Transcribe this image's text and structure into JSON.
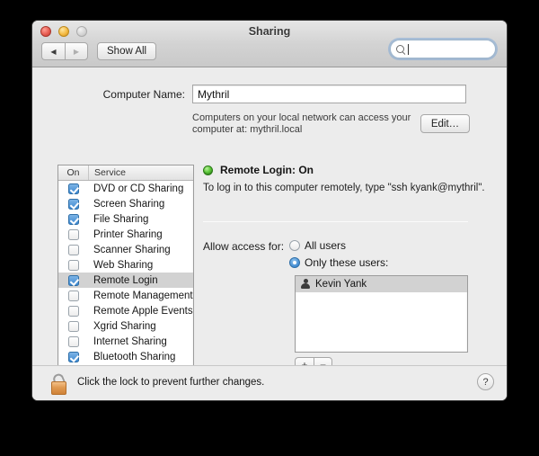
{
  "window": {
    "title": "Sharing",
    "traffic_lights": [
      "close-button",
      "minimize-button",
      "zoom-button"
    ],
    "nav_back": "◀",
    "nav_forward": "▶",
    "show_all_label": "Show All",
    "search_placeholder": "",
    "search_value": ""
  },
  "computer_name": {
    "label": "Computer Name:",
    "value": "Mythril",
    "help_text": "Computers on your local network can access your computer at: mythril.local",
    "edit_label": "Edit…"
  },
  "services": {
    "columns": [
      "On",
      "Service"
    ],
    "rows": [
      {
        "name": "DVD or CD Sharing",
        "on": true,
        "selected": false
      },
      {
        "name": "Screen Sharing",
        "on": true,
        "selected": false
      },
      {
        "name": "File Sharing",
        "on": true,
        "selected": false
      },
      {
        "name": "Printer Sharing",
        "on": false,
        "selected": false
      },
      {
        "name": "Scanner Sharing",
        "on": false,
        "selected": false
      },
      {
        "name": "Web Sharing",
        "on": false,
        "selected": false
      },
      {
        "name": "Remote Login",
        "on": true,
        "selected": true
      },
      {
        "name": "Remote Management",
        "on": false,
        "selected": false
      },
      {
        "name": "Remote Apple Events",
        "on": false,
        "selected": false
      },
      {
        "name": "Xgrid Sharing",
        "on": false,
        "selected": false
      },
      {
        "name": "Internet Sharing",
        "on": false,
        "selected": false
      },
      {
        "name": "Bluetooth Sharing",
        "on": true,
        "selected": false
      }
    ]
  },
  "detail": {
    "status_title": "Remote Login: On",
    "status_color": "#5fc93c",
    "status_description": "To log in to this computer remotely, type \"ssh kyank@mythril\".",
    "allow_label": "Allow access for:",
    "radio_all_users": "All users",
    "radio_only_these": "Only these users:",
    "selected_radio": "only_these",
    "users": [
      {
        "name": "Kevin Yank",
        "selected": true
      }
    ],
    "add_label": "+",
    "remove_label": "−"
  },
  "footer": {
    "lock_state": "unlocked",
    "lock_text": "Click the lock to prevent further changes.",
    "help_label": "?"
  }
}
